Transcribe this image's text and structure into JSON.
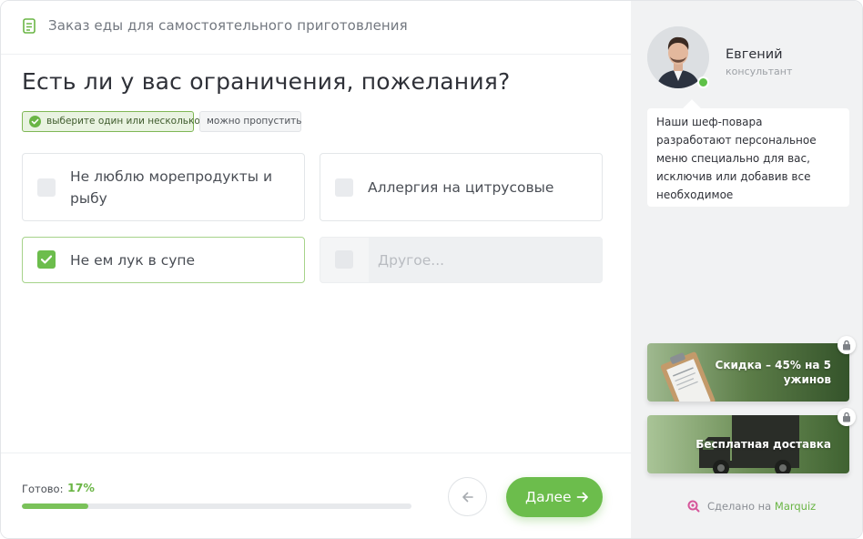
{
  "header": {
    "title": "Заказ еды для самостоятельного приготовления"
  },
  "question": {
    "title": "Есть ли у вас ограничения, пожелания?",
    "hint_multi": "выберите один или несколько",
    "hint_skip": "можно пропустить"
  },
  "options": [
    {
      "label": "Не люблю морепродукты и рыбу",
      "checked": false
    },
    {
      "label": "Аллергия на цитрусовые",
      "checked": false
    },
    {
      "label": "Не ем лук в супе",
      "checked": true
    },
    {
      "label": "",
      "placeholder": "Другое...",
      "checked": false
    }
  ],
  "progress": {
    "label": "Готово:",
    "value_text": "17%",
    "fraction": 0.17
  },
  "nav": {
    "next_label": "Далее"
  },
  "consultant": {
    "name": "Евгений",
    "role": "консультант",
    "message": "Наши шеф-повара разработают персональное меню специально для вас, исключив или добавив все необходимое"
  },
  "bonuses": [
    {
      "text": "Скидка – 45% на 5 ужинов",
      "locked": true
    },
    {
      "text": "Бесплатная доставка",
      "locked": true
    }
  ],
  "footer": {
    "made_prefix": "Сделано на",
    "brand": "Marquiz"
  },
  "colors": {
    "accent": "#6cbd4c",
    "accent_text": "#6ab545"
  }
}
